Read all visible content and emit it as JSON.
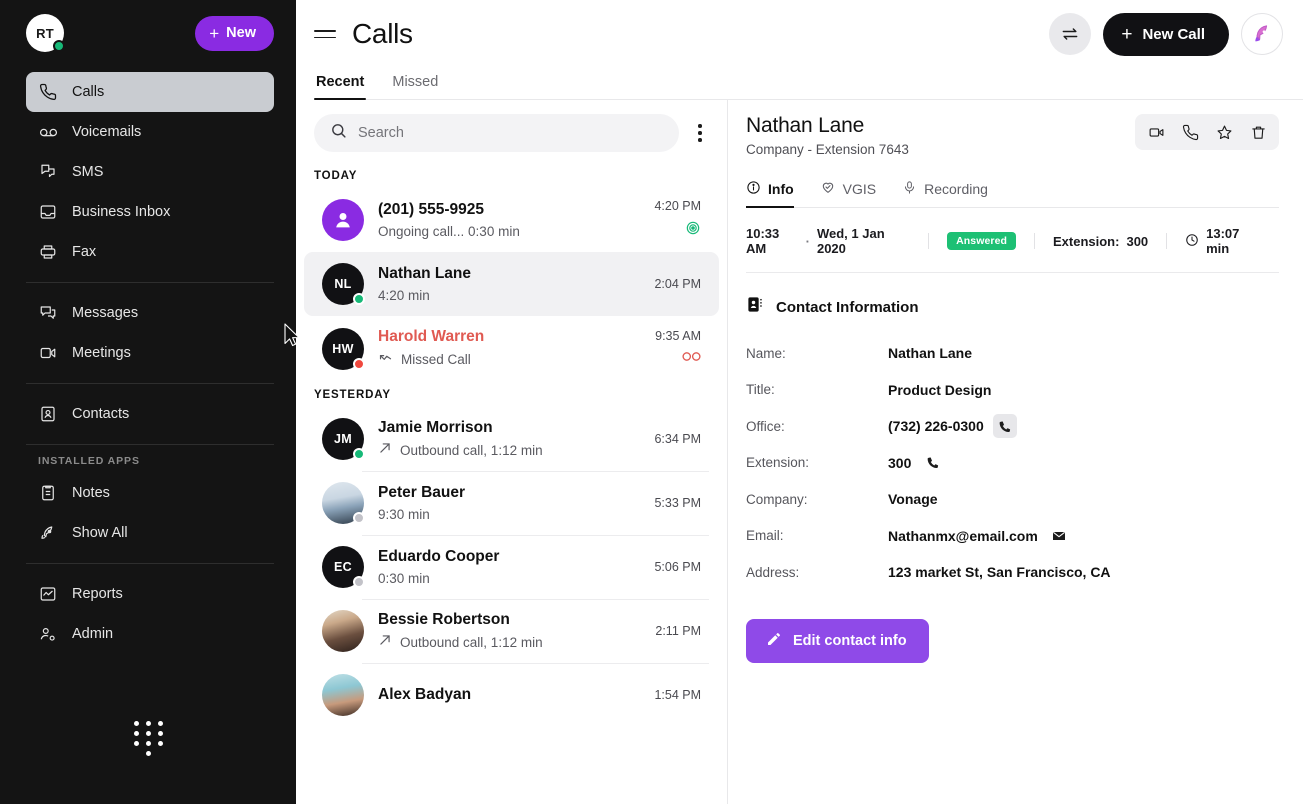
{
  "sidebar": {
    "user_initials": "RT",
    "new_button": "New",
    "installed_apps_label": "INSTALLED APPS",
    "items": [
      {
        "label": "Calls",
        "icon": "phone-icon",
        "active": true
      },
      {
        "label": "Voicemails",
        "icon": "voicemail-icon",
        "active": false
      },
      {
        "label": "SMS",
        "icon": "sms-icon",
        "active": false
      },
      {
        "label": "Business Inbox",
        "icon": "inbox-icon",
        "active": false
      },
      {
        "label": "Fax",
        "icon": "fax-icon",
        "active": false
      },
      {
        "label": "Messages",
        "icon": "messages-icon",
        "active": false
      },
      {
        "label": "Meetings",
        "icon": "video-icon",
        "active": false
      },
      {
        "label": "Contacts",
        "icon": "contacts-icon",
        "active": false
      },
      {
        "label": "Notes",
        "icon": "notes-icon",
        "active": false
      },
      {
        "label": "Show All",
        "icon": "rocket-icon",
        "active": false
      },
      {
        "label": "Reports",
        "icon": "reports-icon",
        "active": false
      },
      {
        "label": "Admin",
        "icon": "admin-icon",
        "active": false
      }
    ]
  },
  "topbar": {
    "title": "Calls",
    "new_call_label": "New Call",
    "transfer_icon": "transfer-icon",
    "rocket_icon": "rocket-icon"
  },
  "tabs": [
    {
      "label": "Recent",
      "active": true
    },
    {
      "label": "Missed",
      "active": false
    }
  ],
  "search": {
    "placeholder": "Search",
    "value": ""
  },
  "call_groups": [
    {
      "label": "TODAY",
      "calls": [
        {
          "name": "(201) 555-9925",
          "sub": "Ongoing call... 0:30 min",
          "time": "4:20 PM",
          "initials": "",
          "avatar_type": "person-purple",
          "avatar_color": "#8a2be2",
          "presence": "",
          "missed": false,
          "direction": "",
          "status_icon": "live-call-icon",
          "selected": false,
          "separator": false
        },
        {
          "name": "Nathan Lane",
          "sub": "4:20 min",
          "time": "2:04 PM",
          "initials": "NL",
          "avatar_type": "initials",
          "avatar_color": "#111114",
          "presence": "online",
          "missed": false,
          "direction": "",
          "status_icon": "",
          "selected": true,
          "separator": false
        },
        {
          "name": "Harold Warren",
          "sub": "Missed Call",
          "time": "9:35 AM",
          "initials": "HW",
          "avatar_type": "initials",
          "avatar_color": "#111114",
          "presence": "busy",
          "missed": true,
          "direction": "missed",
          "status_icon": "voicemail-icon",
          "selected": false,
          "separator": false
        }
      ]
    },
    {
      "label": "YESTERDAY",
      "calls": [
        {
          "name": "Jamie Morrison",
          "sub": "Outbound call, 1:12 min",
          "time": "6:34 PM",
          "initials": "JM",
          "avatar_type": "initials",
          "avatar_color": "#111114",
          "presence": "online",
          "missed": false,
          "direction": "outbound",
          "status_icon": "",
          "selected": false,
          "separator": false
        },
        {
          "name": "Peter Bauer",
          "sub": "9:30 min",
          "time": "5:33 PM",
          "initials": "",
          "avatar_type": "photo-peter",
          "avatar_color": "",
          "presence": "offline",
          "missed": false,
          "direction": "",
          "status_icon": "",
          "selected": false,
          "separator": true
        },
        {
          "name": "Eduardo Cooper",
          "sub": "0:30 min",
          "time": "5:06 PM",
          "initials": "EC",
          "avatar_type": "initials",
          "avatar_color": "#111114",
          "presence": "offline",
          "missed": false,
          "direction": "",
          "status_icon": "",
          "selected": false,
          "separator": true
        },
        {
          "name": "Bessie Robertson",
          "sub": "Outbound call, 1:12 min",
          "time": "2:11 PM",
          "initials": "",
          "avatar_type": "photo-bessie",
          "avatar_color": "",
          "presence": "",
          "missed": false,
          "direction": "outbound",
          "status_icon": "",
          "selected": false,
          "separator": true
        },
        {
          "name": "Alex Badyan",
          "sub": "",
          "time": "1:54 PM",
          "initials": "",
          "avatar_type": "photo-alex",
          "avatar_color": "",
          "presence": "",
          "missed": false,
          "direction": "",
          "status_icon": "",
          "selected": false,
          "separator": true
        }
      ]
    }
  ],
  "detail": {
    "contact_name": "Nathan Lane",
    "contact_sub": "Company -  Extension 7643",
    "actions": [
      "video-icon",
      "phone-icon",
      "star-icon",
      "trash-icon"
    ],
    "tabs": [
      {
        "label": "Info",
        "icon": "info-icon",
        "active": true
      },
      {
        "label": "VGIS",
        "icon": "heart-check-icon",
        "active": false
      },
      {
        "label": "Recording",
        "icon": "microphone-icon",
        "active": false
      }
    ],
    "meta": {
      "time": "10:33 AM",
      "dot": "·",
      "date": "Wed, 1 Jan 2020",
      "status_badge": "Answered",
      "extension_label": "Extension:",
      "extension_value": "300",
      "duration": "13:07 min"
    },
    "section_title": "Contact Information",
    "fields": [
      {
        "label": "Name:",
        "value": "Nathan Lane",
        "icon": ""
      },
      {
        "label": "Title:",
        "value": "Product  Design",
        "icon": ""
      },
      {
        "label": "Office:",
        "value": "(732) 226-0300",
        "icon": "phone-icon",
        "hovered": true
      },
      {
        "label": "Extension:",
        "value": "300",
        "icon": "phone-icon",
        "hovered": false
      },
      {
        "label": "Company:",
        "value": "Vonage",
        "icon": ""
      },
      {
        "label": "Email:",
        "value": "Nathanmx@email.com",
        "icon": "mail-icon",
        "hovered": false
      },
      {
        "label": "Address:",
        "value": "123 market St, San Francisco, CA",
        "icon": ""
      }
    ],
    "edit_button": "Edit contact info"
  },
  "colors": {
    "accent_purple": "#8a2be2",
    "edit_purple": "#8f4ae8",
    "sidebar_bg": "#141414",
    "status_green": "#1dc074",
    "missed_red": "#e05a52"
  }
}
